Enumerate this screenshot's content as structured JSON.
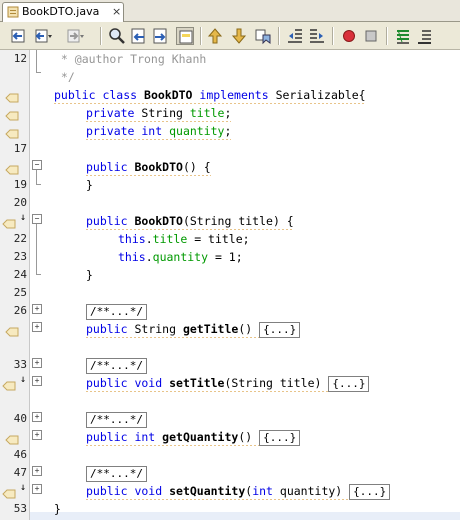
{
  "tab": {
    "label": "BookDTO.java",
    "close": "×"
  },
  "toolbar": {
    "buttons": [
      "back-icon",
      "history-back-icon",
      "history-forward-icon",
      "find-icon",
      "find-previous-icon",
      "find-next-icon",
      "toggle-highlight-icon",
      "previous-bookmark-icon",
      "next-bookmark-icon",
      "toggle-bookmark-icon",
      "shift-left-icon",
      "shift-right-icon",
      "start-macro-icon",
      "stop-macro-icon",
      "comment-icon",
      "uncomment-icon"
    ]
  },
  "gutter": {
    "line_numbers": [
      "12",
      "",
      "",
      "",
      "",
      "17",
      "",
      "19",
      "20",
      "",
      "22",
      "23",
      "24",
      "25",
      "26",
      "",
      "33",
      "",
      "40",
      "",
      "46",
      "47",
      "",
      "53"
    ]
  },
  "code": {
    "l1_comment": " * @author Trong Khanh",
    "l2_comment": " */",
    "l3_kw1": "public class ",
    "l3_name": "BookDTO",
    "l3_kw2": " implements ",
    "l3_rest": "Serializable{",
    "l4_kw": "private ",
    "l4_type": "String ",
    "l4_field": "title",
    "l4_end": ";",
    "l5_kw": "private int ",
    "l5_field": "quantity",
    "l5_end": ";",
    "l7_kw": "public ",
    "l7_name": "BookDTO",
    "l7_rest": "() {",
    "l8": "}",
    "l10_kw": "public ",
    "l10_name": "BookDTO",
    "l10_rest": "(String title) {",
    "l11_this": "this",
    "l11_dot": ".",
    "l11_field": "title",
    "l11_rest": " = title;",
    "l12_this": "this",
    "l12_dot": ".",
    "l12_field": "quantity",
    "l12_rest": " = 1;",
    "l13": "}",
    "fold_comment": "/**...*/",
    "fold_body": "{...}",
    "m1_kw": "public ",
    "m1_type": "String ",
    "m1_name": "getTitle",
    "m1_rest": "() ",
    "m2_kw": "public void ",
    "m2_name": "setTitle",
    "m2_rest": "(String title) ",
    "m3_kw": "public int ",
    "m3_name": "getQuantity",
    "m3_rest": "() ",
    "m4_kw": "public void ",
    "m4_name": "setQuantity",
    "m4_args1": "(",
    "m4_int": "int",
    "m4_args2": " quantity) ",
    "close_class": "}"
  },
  "colors": {
    "keyword": "#0000e6",
    "field": "#009900",
    "comment": "#969696"
  }
}
